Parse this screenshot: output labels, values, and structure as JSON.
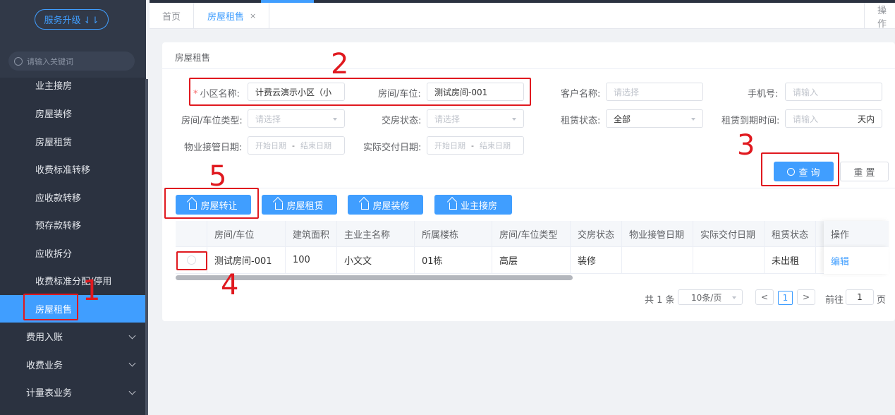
{
  "sidebar": {
    "upgrade_label": "服务升级 ⇃⇂",
    "search_placeholder": "请输入关键词",
    "items": [
      {
        "label": "业主接房"
      },
      {
        "label": "房屋装修"
      },
      {
        "label": "房屋租赁"
      },
      {
        "label": "收费标准转移"
      },
      {
        "label": "应收款转移"
      },
      {
        "label": "预存款转移"
      },
      {
        "label": "应收拆分"
      },
      {
        "label": "收费标准分配/停用"
      },
      {
        "label": "房屋租售"
      }
    ],
    "groups": [
      {
        "label": "费用入账"
      },
      {
        "label": "收费业务"
      },
      {
        "label": "计量表业务"
      }
    ]
  },
  "tabs": {
    "home": "首页",
    "current": "房屋租售",
    "close": "×",
    "operations": "操作"
  },
  "page": {
    "title": "房屋租售"
  },
  "filters": {
    "community_label": "小区名称:",
    "community_value": "计费云演示小区（小",
    "room_label": "房间/车位:",
    "room_value": "测试房间-001",
    "customer_label": "客户名称:",
    "customer_placeholder": "请选择",
    "phone_label": "手机号:",
    "phone_placeholder": "请输入",
    "room_type_label": "房间/车位类型:",
    "room_type_placeholder": "请选择",
    "handover_label": "交房状态:",
    "handover_placeholder": "请选择",
    "lease_label": "租赁状态:",
    "lease_value": "全部",
    "lease_expire_label": "租赁到期时间:",
    "lease_expire_placeholder": "请输入",
    "lease_expire_suffix": "天内",
    "property_date_label": "物业接管日期:",
    "actual_date_label": "实际交付日期:",
    "start_placeholder": "开始日期",
    "end_placeholder": "结束日期",
    "range_sep": "-",
    "query_button": "查 询",
    "reset_button": "重 置"
  },
  "actions": {
    "transfer": "房屋转让",
    "rent": "房屋租赁",
    "decorate": "房屋装修",
    "owner_receive": "业主接房"
  },
  "table": {
    "columns": [
      "房间/车位",
      "建筑面积",
      "主业主名称",
      "所属楼栋",
      "房间/车位类型",
      "交房状态",
      "物业接管日期",
      "实际交付日期",
      "租赁状态"
    ],
    "op_header": "操作",
    "rows": [
      {
        "room": "测试房间-001",
        "area": "100",
        "owner": "小文文",
        "building": "01栋",
        "type": "高层",
        "handover": "装修",
        "property_date": "",
        "actual_date": "",
        "lease": "未出租",
        "op": "编辑"
      }
    ]
  },
  "pagination": {
    "total": "共 1 条",
    "page_size": "10条/页",
    "current": "1",
    "goto_label": "前往",
    "goto_value": "1",
    "page_suffix": "页",
    "prev": "<",
    "next": ">"
  },
  "annotations": {
    "n1": "1",
    "n2": "2",
    "n3": "3",
    "n4": "4",
    "n5": "5"
  }
}
